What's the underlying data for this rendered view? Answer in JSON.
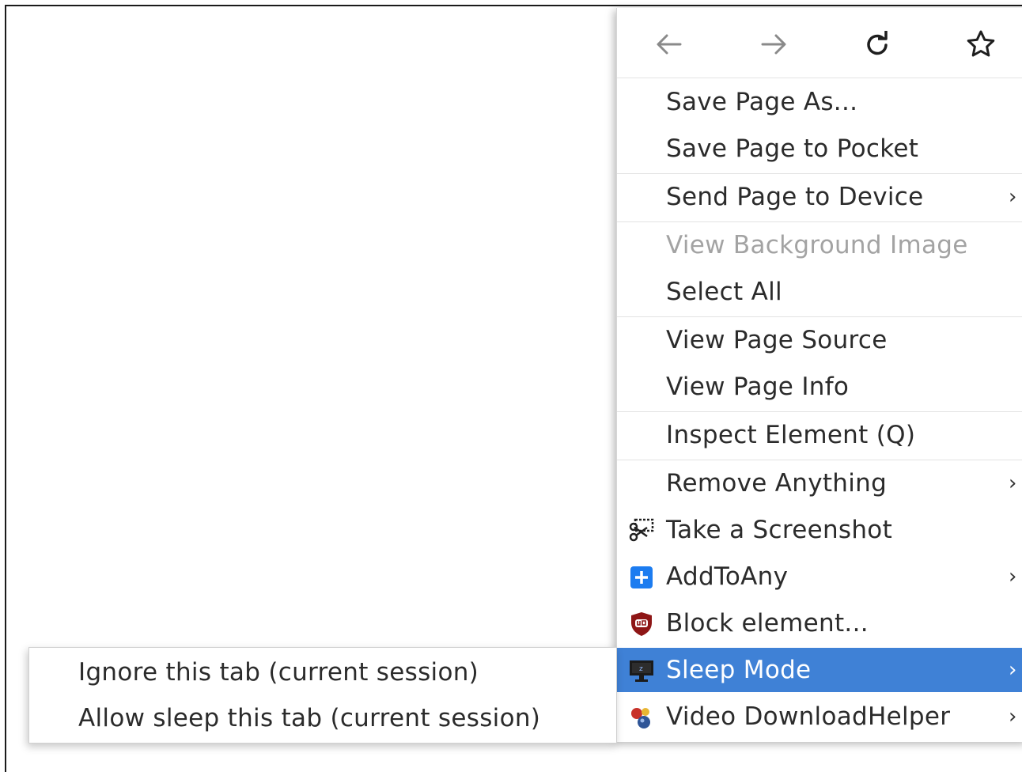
{
  "nav": {
    "back_icon": "arrow-left-icon",
    "forward_icon": "arrow-right-icon",
    "reload_icon": "reload-icon",
    "bookmark_icon": "star-icon"
  },
  "menu": {
    "save_page_as": "Save Page As...",
    "save_to_pocket": "Save Page to Pocket",
    "send_to_device": "Send Page to Device",
    "view_background_image": "View Background Image",
    "select_all": "Select All",
    "view_page_source": "View Page Source",
    "view_page_info": "View Page Info",
    "inspect_element": "Inspect Element (Q)",
    "remove_anything": "Remove Anything",
    "take_screenshot": "Take a Screenshot",
    "add_to_any": "AddToAny",
    "block_element": "Block element...",
    "sleep_mode": "Sleep Mode",
    "video_downloadhelper": "Video DownloadHelper",
    "chevron": "›"
  },
  "submenu": {
    "ignore_tab": "Ignore this tab (current session)",
    "allow_sleep": "Allow sleep this tab (current session)"
  },
  "colors": {
    "highlight": "#3f81d6",
    "disabled_text": "#a3a3a3"
  }
}
